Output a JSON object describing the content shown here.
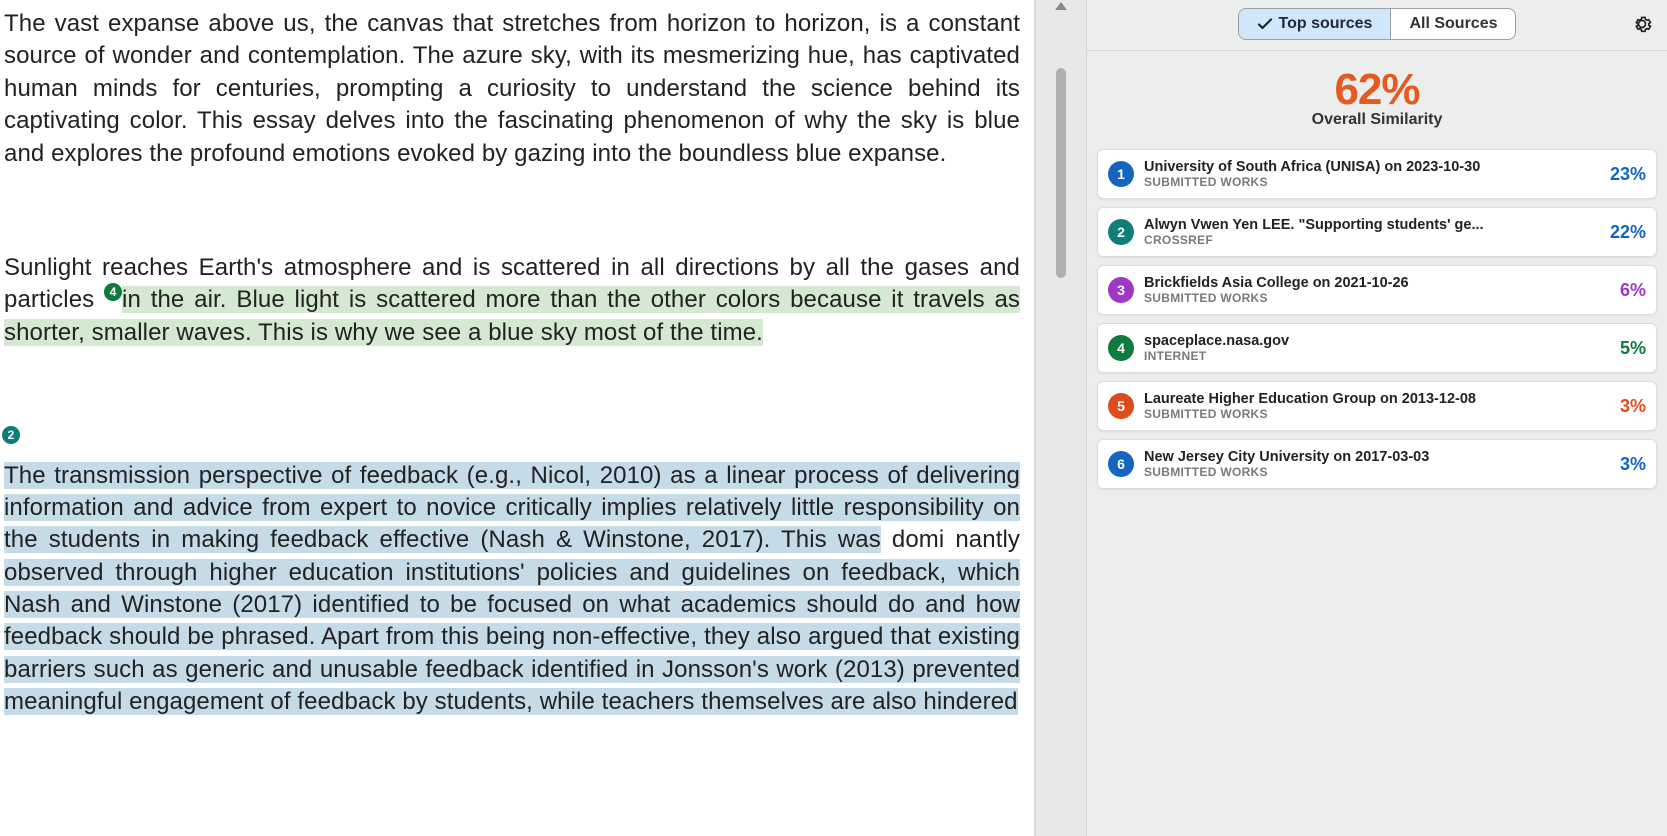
{
  "document": {
    "para1": "The vast expanse above us, the canvas that stretches from horizon to horizon, is a constant source of wonder and contemplation. The azure sky, with its mesmerizing hue, has captivated human minds for centuries, prompting a curiosity to understand the science behind its captivating color. This essay delves into the fascinating phenomenon of why the sky is blue and explores the profound emotions evoked by gazing into the boundless blue expanse.",
    "para2_plain_a": "Sunlight reaches Earth's atmosphere and is scattered in all directions by all the gases and particles ",
    "para2_badge": "4",
    "para2_hl": "in the air. Blue light is scattered more than the other colors because it travels as shorter, smaller waves. This is why we see a blue sky most of the time.",
    "para3_badge": "2",
    "para3_hl_a": "The transmission perspective of feedback (e.g., Nicol, 2010) as a linear process of delivering information and advice from expert to novice critically implies relatively little responsibility on the students in making feedback effective (Nash & Winstone, 2017). This was",
    "para3_plain_gap": " domi nantly ",
    "para3_hl_b": "observed through higher education institutions' policies and guidelines on feedback, which Nash and Winstone (2017) identified to be focused on what academics should do and how feedback should be phrased. Apart from this being non-effective, they also argued that existing barriers such as generic and unusable feedback identified in Jonsson's work (2013) prevented meaningful engagement of feedback by students, while teachers themselves are also hindered"
  },
  "sidebar": {
    "tabs": {
      "top_sources": "Top sources",
      "all_sources": "All Sources"
    },
    "score": {
      "percent": "62%",
      "label": "Overall Similarity"
    },
    "sources": [
      {
        "n": "1",
        "title": "University of South Africa (UNISA) on 2023-10-30",
        "sub": "SUBMITTED WORKS",
        "pct": "23%",
        "color": "c1",
        "pctColor": "pct-blue"
      },
      {
        "n": "2",
        "title": "Alwyn Vwen Yen LEE. \"Supporting students' ge...",
        "sub": "CROSSREF",
        "pct": "22%",
        "color": "c2",
        "pctColor": "pct-blue"
      },
      {
        "n": "3",
        "title": "Brickfields Asia College on 2021-10-26",
        "sub": "SUBMITTED WORKS",
        "pct": "6%",
        "color": "c3",
        "pctColor": "pct-purple"
      },
      {
        "n": "4",
        "title": "spaceplace.nasa.gov",
        "sub": "INTERNET",
        "pct": "5%",
        "color": "c4",
        "pctColor": "pct-green"
      },
      {
        "n": "5",
        "title": "Laureate Higher Education Group on 2013-12-08",
        "sub": "SUBMITTED WORKS",
        "pct": "3%",
        "color": "c5",
        "pctColor": "pct-orange"
      },
      {
        "n": "6",
        "title": "New Jersey City University on 2017-03-03",
        "sub": "SUBMITTED WORKS",
        "pct": "3%",
        "color": "c6",
        "pctColor": "pct-blue"
      }
    ]
  }
}
